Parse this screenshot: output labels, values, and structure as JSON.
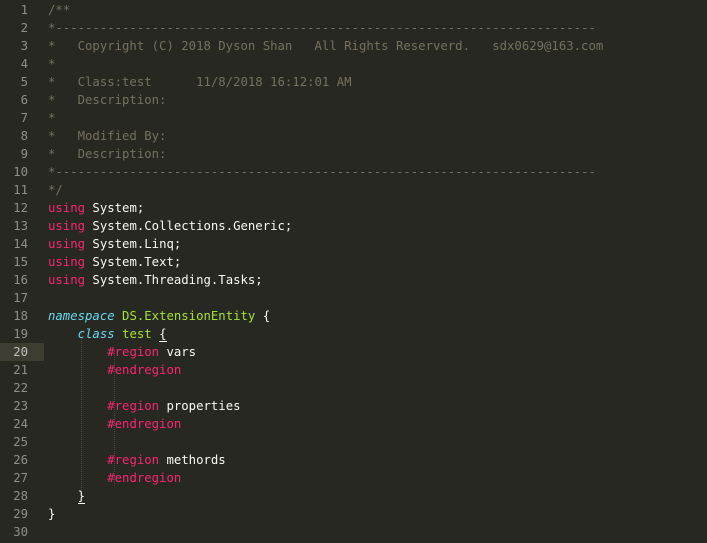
{
  "editor": {
    "current_line": 20,
    "line_numbers": [
      "1",
      "2",
      "3",
      "4",
      "5",
      "6",
      "7",
      "8",
      "9",
      "10",
      "11",
      "12",
      "13",
      "14",
      "15",
      "16",
      "17",
      "18",
      "19",
      "20",
      "21",
      "22",
      "23",
      "24",
      "25",
      "26",
      "27",
      "28",
      "29",
      "30"
    ],
    "lines": [
      [
        {
          "t": "/**",
          "c": "cmt"
        }
      ],
      [
        {
          "t": "*-------------------------------------------------------------------------",
          "c": "cmt"
        }
      ],
      [
        {
          "t": "*   Copyright (C) 2018 Dyson Shan   All Rights Reserverd.   sdx0629@163.com",
          "c": "cmt"
        }
      ],
      [
        {
          "t": "*",
          "c": "cmt"
        }
      ],
      [
        {
          "t": "*   Class:test      11/8/2018 16:12:01 AM",
          "c": "cmt"
        }
      ],
      [
        {
          "t": "*   Description:",
          "c": "cmt"
        }
      ],
      [
        {
          "t": "*",
          "c": "cmt"
        }
      ],
      [
        {
          "t": "*   Modified By:",
          "c": "cmt"
        }
      ],
      [
        {
          "t": "*   Description:",
          "c": "cmt"
        }
      ],
      [
        {
          "t": "*-------------------------------------------------------------------------",
          "c": "cmt"
        }
      ],
      [
        {
          "t": "*/",
          "c": "cmt"
        }
      ],
      [
        {
          "t": "using",
          "c": "kw"
        },
        {
          "t": " System;",
          "c": "id"
        }
      ],
      [
        {
          "t": "using",
          "c": "kw"
        },
        {
          "t": " System.Collections.Generic;",
          "c": "id"
        }
      ],
      [
        {
          "t": "using",
          "c": "kw"
        },
        {
          "t": " System.Linq;",
          "c": "id"
        }
      ],
      [
        {
          "t": "using",
          "c": "kw"
        },
        {
          "t": " System.Text;",
          "c": "id"
        }
      ],
      [
        {
          "t": "using",
          "c": "kw"
        },
        {
          "t": " System.Threading.Tasks;",
          "c": "id"
        }
      ],
      [],
      [
        {
          "t": "namespace",
          "c": "ns"
        },
        {
          "t": " ",
          "c": "id"
        },
        {
          "t": "DS.ExtensionEntity",
          "c": "ent"
        },
        {
          "t": " {",
          "c": "id"
        }
      ],
      [
        {
          "t": "    ",
          "c": "id"
        },
        {
          "t": "class",
          "c": "cls"
        },
        {
          "t": " ",
          "c": "id"
        },
        {
          "t": "test",
          "c": "ent"
        },
        {
          "t": " ",
          "c": "id"
        },
        {
          "t": "{",
          "c": "id brace-match"
        }
      ],
      [
        {
          "t": "        ",
          "c": "id"
        },
        {
          "t": "#region",
          "c": "kw"
        },
        {
          "t": " vars",
          "c": "id"
        }
      ],
      [
        {
          "t": "        ",
          "c": "id"
        },
        {
          "t": "#endregion",
          "c": "kw"
        }
      ],
      [],
      [
        {
          "t": "        ",
          "c": "id"
        },
        {
          "t": "#region",
          "c": "kw"
        },
        {
          "t": " properties",
          "c": "id"
        }
      ],
      [
        {
          "t": "        ",
          "c": "id"
        },
        {
          "t": "#endregion",
          "c": "kw"
        }
      ],
      [],
      [
        {
          "t": "        ",
          "c": "id"
        },
        {
          "t": "#region",
          "c": "kw"
        },
        {
          "t": " methords",
          "c": "id"
        }
      ],
      [
        {
          "t": "        ",
          "c": "id"
        },
        {
          "t": "#endregion",
          "c": "kw"
        }
      ],
      [
        {
          "t": "    ",
          "c": "id"
        },
        {
          "t": "}",
          "c": "id brace-match"
        }
      ],
      [
        {
          "t": "}",
          "c": "id"
        }
      ],
      []
    ]
  }
}
